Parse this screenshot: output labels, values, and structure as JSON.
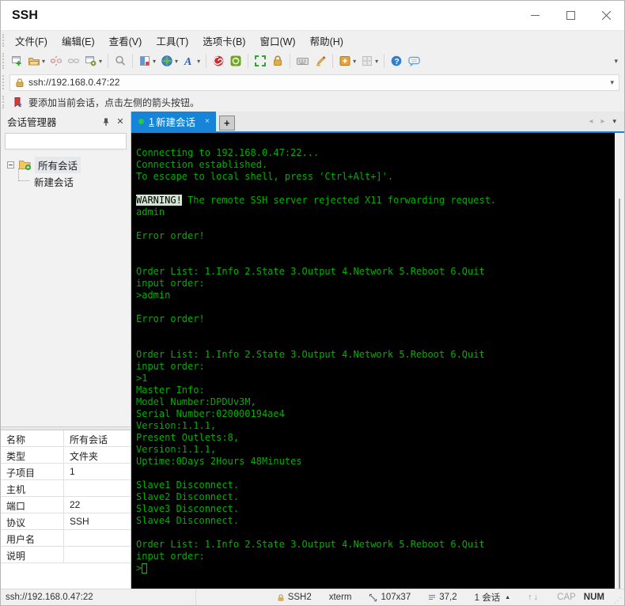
{
  "window": {
    "title": "SSH"
  },
  "window_controls": {
    "minimize": "minimize",
    "maximize": "maximize",
    "close": "close"
  },
  "menu": {
    "items": [
      "文件(F)",
      "编辑(E)",
      "查看(V)",
      "工具(T)",
      "选项卡(B)",
      "窗口(W)",
      "帮助(H)"
    ]
  },
  "toolbar_icons": [
    "new-session-icon",
    "open-session-icon",
    "disconnect-icon",
    "reconnect-icon",
    "session-properties-icon",
    "find-icon",
    "compose-icon",
    "encoding-globe-icon",
    "font-icon",
    "trace-icon",
    "transfer-icon",
    "fullscreen-icon",
    "lock-screen-icon",
    "virtual-keyboard-icon",
    "highlight-pen-icon",
    "new-file-icon",
    "layout-icon",
    "help-icon",
    "feedback-icon"
  ],
  "address_bar": {
    "value": "ssh://192.168.0.47:22"
  },
  "info_bar": {
    "text": "要添加当前会话，点击左侧的箭头按钮。"
  },
  "sidebar": {
    "title": "会话管理器",
    "search_placeholder": "",
    "tree": {
      "root_label": "所有会话",
      "child_label": "新建会话"
    },
    "properties": [
      {
        "label": "名称",
        "value": "所有会话"
      },
      {
        "label": "类型",
        "value": "文件夹"
      },
      {
        "label": "子项目",
        "value": "1"
      },
      {
        "label": "主机",
        "value": ""
      },
      {
        "label": "端口",
        "value": "22"
      },
      {
        "label": "协议",
        "value": "SSH"
      },
      {
        "label": "用户名",
        "value": ""
      },
      {
        "label": "说明",
        "value": ""
      }
    ]
  },
  "tabs": {
    "active_index": "1",
    "active_label": "新建会话",
    "close": "×",
    "new_tab": "+"
  },
  "terminal": {
    "lines": [
      [
        {
          "t": "Connecting to 192.168.0.47:22..."
        }
      ],
      [
        {
          "t": "Connection established."
        }
      ],
      [
        {
          "t": "To escape to local shell, press 'Ctrl+Alt+]'."
        }
      ],
      [],
      [
        {
          "t": "WARNING!",
          "s": "inverse"
        },
        {
          "t": " The remote SSH server rejected X11 forwarding request."
        }
      ],
      [
        {
          "t": "admin"
        }
      ],
      [],
      [
        {
          "t": "Error order!"
        }
      ],
      [],
      [],
      [
        {
          "t": "Order List: 1.Info 2.State 3.Output 4.Network 5.Reboot 6.Quit"
        }
      ],
      [
        {
          "t": "input order:"
        }
      ],
      [
        {
          "t": ">admin"
        }
      ],
      [],
      [
        {
          "t": "Error order!"
        }
      ],
      [],
      [],
      [
        {
          "t": "Order List: 1.Info 2.State 3.Output 4.Network 5.Reboot 6.Quit"
        }
      ],
      [
        {
          "t": "input order:"
        }
      ],
      [
        {
          "t": ">1"
        }
      ],
      [
        {
          "t": "Master Info:"
        }
      ],
      [
        {
          "t": "Model Number:DPDUv3M,"
        }
      ],
      [
        {
          "t": "Serial Number:020000194ae4"
        }
      ],
      [
        {
          "t": "Version:1.1.1,"
        }
      ],
      [
        {
          "t": "Present Outlets:8,"
        }
      ],
      [
        {
          "t": "Version:1.1.1,"
        }
      ],
      [
        {
          "t": "Uptime:0Days 2Hours 48Minutes"
        }
      ],
      [],
      [
        {
          "t": "Slave1 Disconnect."
        }
      ],
      [
        {
          "t": "Slave2 Disconnect."
        }
      ],
      [
        {
          "t": "Slave3 Disconnect."
        }
      ],
      [
        {
          "t": "Slave4 Disconnect."
        }
      ],
      [],
      [
        {
          "t": "Order List: 1.Info 2.State 3.Output 4.Network 5.Reboot 6.Quit"
        }
      ],
      [
        {
          "t": "input order:"
        }
      ],
      [
        {
          "t": ">"
        },
        {
          "t": " ",
          "s": "cursor"
        }
      ]
    ]
  },
  "status_bar": {
    "url": "ssh://192.168.0.47:22",
    "protocol": "SSH2",
    "term_type": "xterm",
    "size": "107x37",
    "cursor_pos": "37,2",
    "session_count": "1 会话",
    "cap": "CAP",
    "num": "NUM"
  },
  "colors": {
    "terminal_bg": "#000000",
    "terminal_text": "#00b000",
    "warning_inverse_bg": "#d2e4d2",
    "active_tab": "#1584d9",
    "tab_dot": "#27c93f"
  }
}
